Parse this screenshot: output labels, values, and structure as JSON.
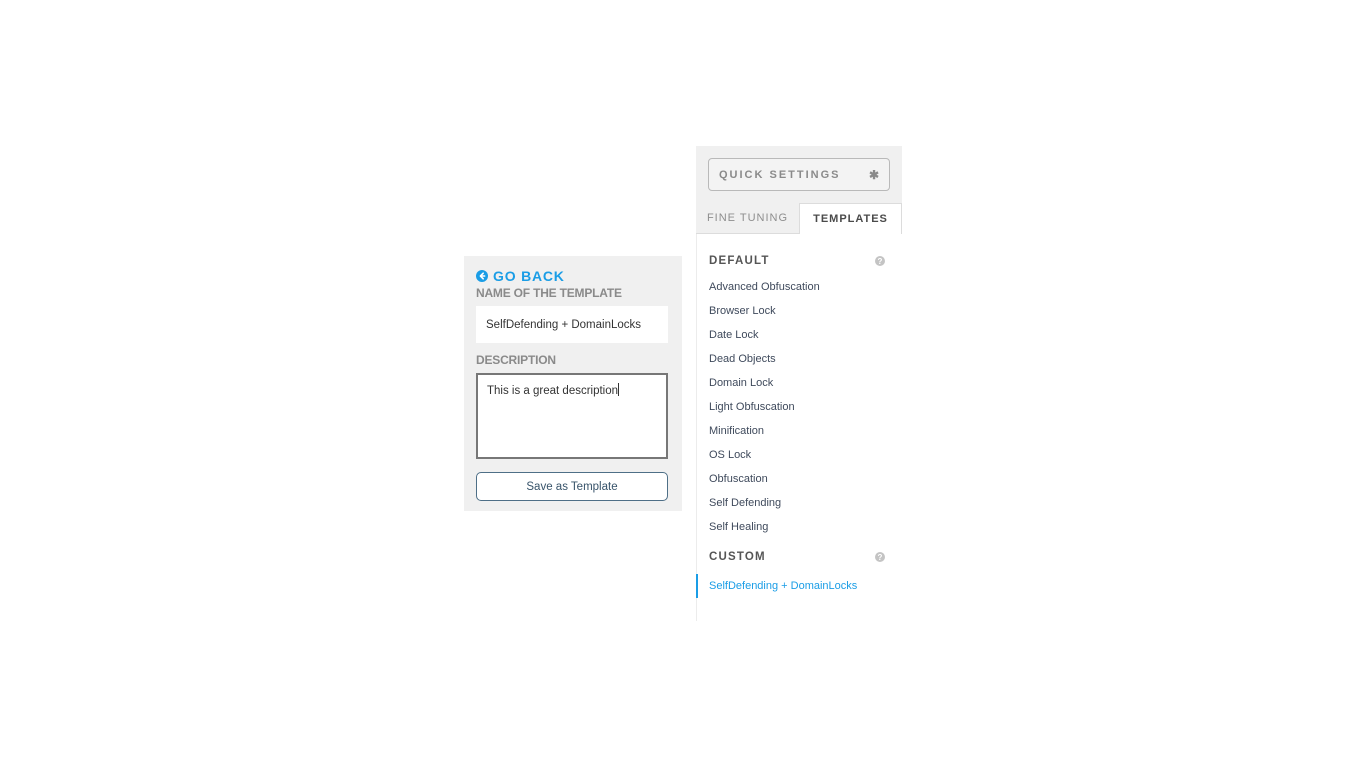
{
  "left_panel": {
    "go_back_label": "GO BACK",
    "name_label": "NAME OF THE TEMPLATE",
    "name_value": "SelfDefending + DomainLocks",
    "description_label": "DESCRIPTION",
    "description_value": "This is a great description",
    "save_button_label": "Save as Template"
  },
  "right_panel": {
    "quick_settings_label": "QUICK SETTINGS",
    "tabs": [
      {
        "label": "FINE TUNING",
        "active": false
      },
      {
        "label": "TEMPLATES",
        "active": true
      }
    ],
    "default_section": {
      "title": "DEFAULT",
      "items": [
        "Advanced Obfuscation",
        "Browser Lock",
        "Date Lock",
        "Dead Objects",
        "Domain Lock",
        "Light Obfuscation",
        "Minification",
        "OS Lock",
        "Obfuscation",
        "Self Defending",
        "Self Healing"
      ]
    },
    "custom_section": {
      "title": "CUSTOM",
      "items": [
        "SelfDefending + DomainLocks"
      ],
      "active_item": "SelfDefending + DomainLocks"
    }
  },
  "icons": {
    "go_back": "arrow-circle-left-icon",
    "quick_settings": "gear-icon",
    "help": "question-circle-icon",
    "gear_glyph": "✱",
    "help_glyph": "?"
  },
  "colors": {
    "accent": "#1a9de6",
    "panel_bg": "#f0f0f0"
  }
}
